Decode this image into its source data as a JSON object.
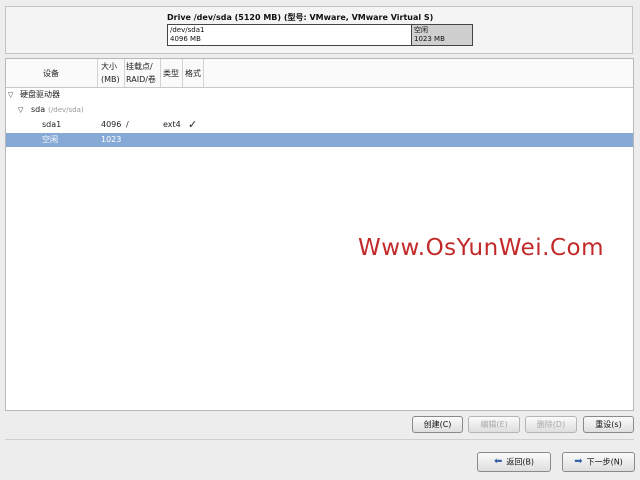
{
  "drive": {
    "title": "Drive /dev/sda (5120 MB) (型号: VMware, VMware Virtual S)",
    "segments": [
      {
        "name": "/dev/sda1",
        "size": "4096 MB"
      },
      {
        "name": "空闲",
        "size": "1023 MB"
      }
    ]
  },
  "table": {
    "headers": {
      "device": "设备",
      "size_line1": "大小",
      "size_line2": "(MB)",
      "mount_line1": "挂载点/",
      "mount_line2": "RAID/卷",
      "type": "类型",
      "format": "格式"
    },
    "rows": [
      {
        "device": "硬盘驱动器",
        "expander": "▽"
      },
      {
        "device": "sda",
        "sub": "(/dev/sda)",
        "expander": "▽"
      },
      {
        "device": "sda1",
        "size": "4096",
        "mount": "/",
        "type": "ext4",
        "format": "✓"
      },
      {
        "device": "空闲",
        "size": "1023",
        "selected": true
      }
    ]
  },
  "buttons": {
    "create": "创建(C)",
    "edit": "编辑(E)",
    "delete": "删除(D)",
    "reset": "重设(s)",
    "back": "返回(B)",
    "next": "下一步(N)"
  },
  "watermark": "Www.OsYunWei.Com",
  "colors": {
    "selected_row": "#86a9d6",
    "watermark": "#c22a2a",
    "free_segment": "#cfcfcf"
  }
}
